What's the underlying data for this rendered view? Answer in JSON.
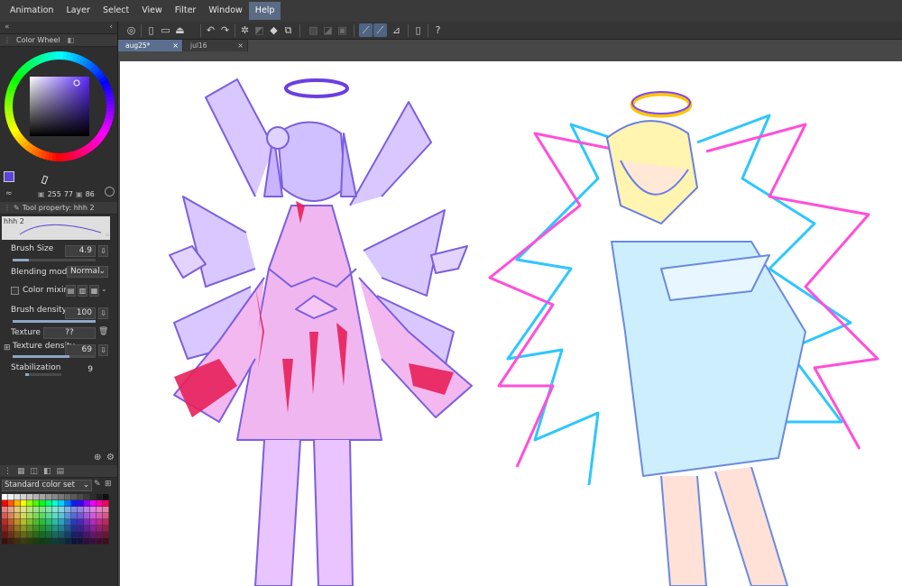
{
  "menu": {
    "items": [
      {
        "label": "Animation",
        "active": false
      },
      {
        "label": "Layer",
        "active": false
      },
      {
        "label": "Select",
        "active": false
      },
      {
        "label": "View",
        "active": false
      },
      {
        "label": "Filter",
        "active": false
      },
      {
        "label": "Window",
        "active": false
      },
      {
        "label": "Help",
        "active": true
      }
    ]
  },
  "color_wheel": {
    "panel_title": "Color Wheel",
    "current_color": "#5b44d6",
    "r": "255",
    "g": "77",
    "b": "86"
  },
  "tool_property": {
    "panel_title": "Tool property: hhh 2",
    "brush_name": "hhh 2",
    "brush_size_label": "Brush Size",
    "brush_size_value": "4.9",
    "blending_mode_label": "Blending mode",
    "blending_mode_value": "Normal",
    "color_mixing_label": "Color mixing",
    "brush_density_label": "Brush density",
    "brush_density_value": "100",
    "texture_label": "Texture",
    "texture_value": "??",
    "texture_density_label": "Texture density",
    "texture_density_value": "69",
    "stabilization_label": "Stabilization",
    "stabilization_value": "9"
  },
  "color_set": {
    "selected": "Standard color set"
  },
  "tabs": [
    {
      "label": "aug25*",
      "active": true
    },
    {
      "label": "jul16",
      "active": false
    }
  ],
  "colors": {
    "accent": "#5a6f8f",
    "panel_bg": "#2e2e2e",
    "canvas_bg": "#ffffff"
  }
}
